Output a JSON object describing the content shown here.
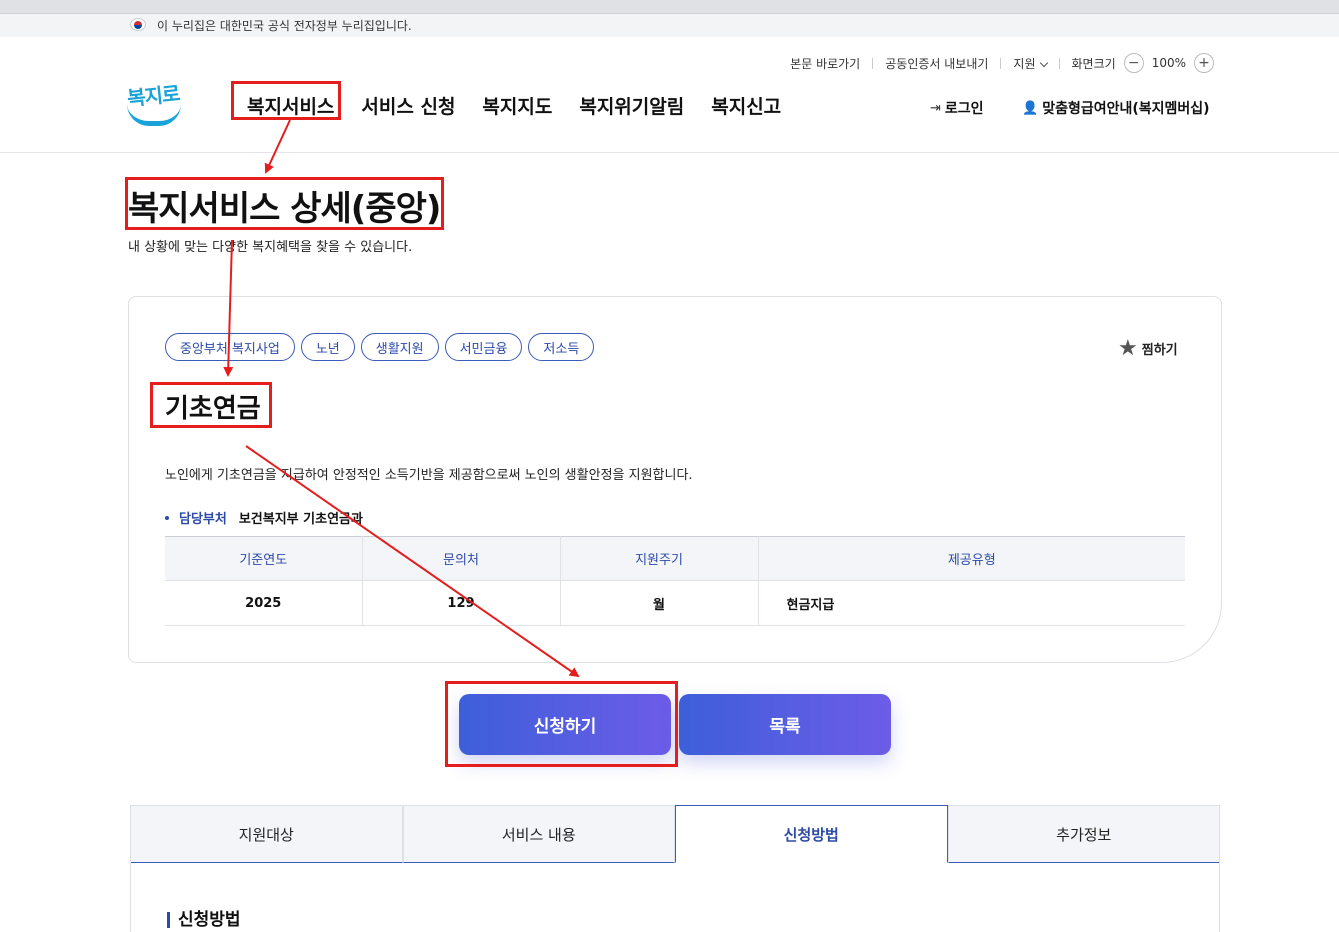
{
  "gov_banner": {
    "text": "이 누리집은 대한민국 공식 전자정부 누리집입니다."
  },
  "utility": {
    "skip": "본문 바로가기",
    "cert": "공동인증서 내보내기",
    "support": "지원",
    "screen_size": "화면크기",
    "zoom_out": "−",
    "zoom_level": "100%",
    "zoom_in": "+"
  },
  "logo": {
    "text": "복지로"
  },
  "nav": {
    "items": [
      "복지서비스",
      "서비스 신청",
      "복지지도",
      "복지위기알림",
      "복지신고"
    ]
  },
  "account": {
    "login": "로그인",
    "membership": "맞춤형급여안내(복지멤버십)"
  },
  "page": {
    "title": "복지서비스 상세(중앙)",
    "subtitle": "내 상황에 맞는 다양한 복지혜택을 찾을 수 있습니다."
  },
  "service": {
    "tags": [
      "중앙부처 복지사업",
      "노년",
      "생활지원",
      "서민금융",
      "저소득"
    ],
    "favorite": "찜하기",
    "name": "기초연금",
    "description": "노인에게 기초연금을 지급하여 안정적인 소득기반을 제공함으로써 노인의 생활안정을 지원합니다.",
    "dept_label": "담당부처",
    "dept_value": "보건복지부 기초연금과",
    "table": {
      "headers": [
        "기준연도",
        "문의처",
        "지원주기",
        "제공유형"
      ],
      "row": [
        "2025",
        "129",
        "월",
        "현금지급"
      ]
    }
  },
  "buttons": {
    "apply": "신청하기",
    "list": "목록"
  },
  "tabs": [
    "지원대상",
    "서비스 내용",
    "신청방법",
    "추가정보"
  ],
  "section": {
    "heading": "신청방법"
  },
  "colors": {
    "accent": "#2d4aa8",
    "annotation": "#e51d1d",
    "logo": "#1aa3d9"
  }
}
